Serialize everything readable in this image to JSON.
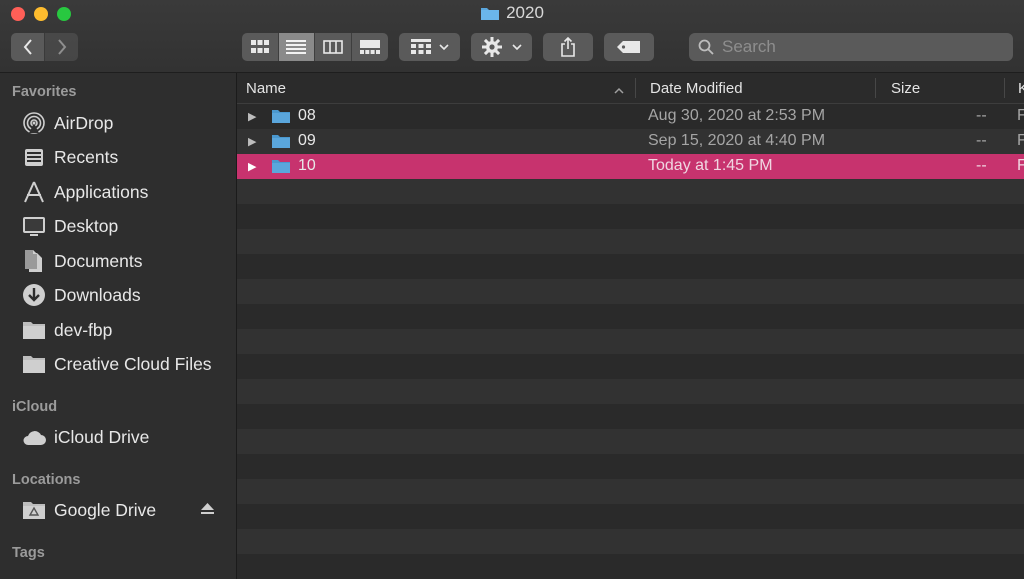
{
  "window": {
    "title": "2020"
  },
  "toolbar": {
    "search_placeholder": "Search"
  },
  "sidebar": {
    "favorites_title": "Favorites",
    "favorites": [
      {
        "label": "AirDrop",
        "icon": "airdrop-icon"
      },
      {
        "label": "Recents",
        "icon": "recents-icon"
      },
      {
        "label": "Applications",
        "icon": "applications-icon"
      },
      {
        "label": "Desktop",
        "icon": "desktop-icon"
      },
      {
        "label": "Documents",
        "icon": "documents-icon"
      },
      {
        "label": "Downloads",
        "icon": "downloads-icon"
      },
      {
        "label": "dev-fbp",
        "icon": "folder-icon"
      },
      {
        "label": "Creative Cloud Files",
        "icon": "folder-icon"
      }
    ],
    "icloud_title": "iCloud",
    "icloud": [
      {
        "label": "iCloud Drive",
        "icon": "cloud-icon"
      }
    ],
    "locations_title": "Locations",
    "locations": [
      {
        "label": "Google Drive",
        "icon": "drive-icon"
      }
    ],
    "tags_title": "Tags"
  },
  "list": {
    "columns": {
      "name": "Name",
      "date": "Date Modified",
      "size": "Size",
      "kind": "K"
    },
    "rows": [
      {
        "name": "08",
        "date": "Aug 30, 2020 at 2:53 PM",
        "size": "--",
        "kind": "F"
      },
      {
        "name": "09",
        "date": "Sep 15, 2020 at 4:40 PM",
        "size": "--",
        "kind": "F"
      },
      {
        "name": "10",
        "date": "Today at 1:45 PM",
        "size": "--",
        "kind": "F"
      }
    ]
  },
  "colors": {
    "selection": "#c7336e",
    "folder": "#5aa6dc"
  }
}
